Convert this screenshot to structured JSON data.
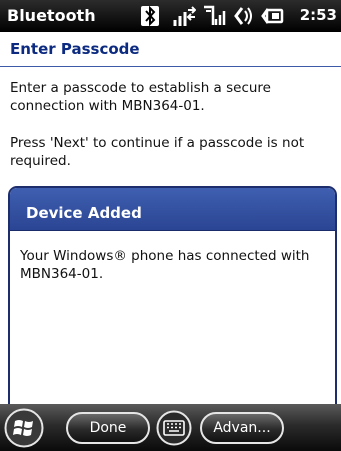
{
  "status_bar": {
    "title": "Bluetooth",
    "time": "2:53",
    "icons": [
      "bluetooth-icon",
      "data-connection-icon",
      "signal-strength-icon",
      "volume-icon",
      "battery-icon"
    ]
  },
  "page": {
    "title": "Enter Passcode",
    "instruction_1": "Enter a passcode to establish a secure connection with MBN364-01.",
    "instruction_2": "Press 'Next' to continue if a passcode is not required."
  },
  "dialog": {
    "title": "Device Added",
    "message": "Your Windows® phone has connected with MBN364-01."
  },
  "softkeys": {
    "left_label": "Done",
    "right_label": "Advan..."
  },
  "colors": {
    "title_blue": "#0b2a80",
    "dialog_header": "#2f4d9e",
    "status_bar": "#000000"
  }
}
